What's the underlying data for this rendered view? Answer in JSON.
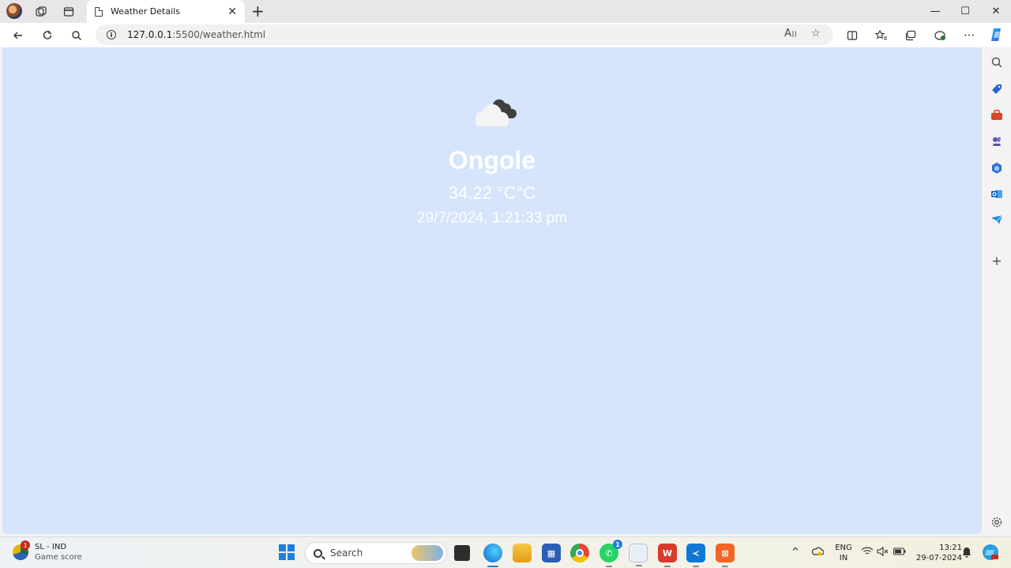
{
  "browser": {
    "tab": {
      "title": "Weather Details",
      "close_glyph": "✕"
    },
    "new_tab_glyph": "+",
    "window_controls": {
      "minimize": "—",
      "maximize": "☐",
      "close": "✕"
    },
    "address": {
      "host": "127.0.0.1",
      "path": ":5500/weather.html"
    }
  },
  "weather": {
    "icon": "cloud-icon",
    "city": "Ongole",
    "temperature": "34.22 °C°C",
    "datetime": "29/7/2024, 1:21:33 pm",
    "text_color": "#ffffff",
    "background_color": "#d6e4fc"
  },
  "taskbar": {
    "widget": {
      "title": "SL - IND",
      "subtitle": "Game score",
      "badge": "1"
    },
    "search_placeholder": "Search",
    "whatsapp_badge": "1",
    "language": {
      "line1": "ENG",
      "line2": "IN"
    },
    "clock": {
      "time": "13:21",
      "date": "29-07-2024"
    }
  }
}
